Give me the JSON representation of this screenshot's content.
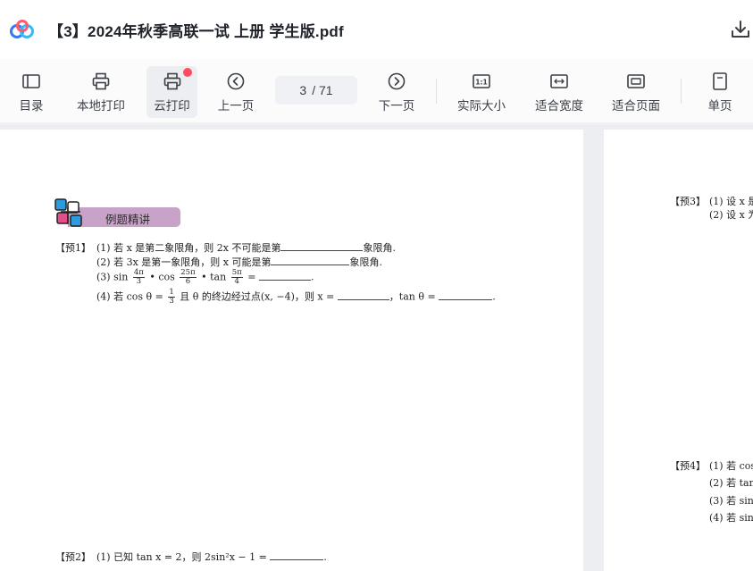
{
  "window": {
    "title": "【3】2024年秋季高联一试 上册 学生版.pdf"
  },
  "toolbar": {
    "toc": "目录",
    "local_print": "本地打印",
    "cloud_print": "云打印",
    "prev_page": "上一页",
    "page_current": "3",
    "page_total": "/ 71",
    "next_page": "下一页",
    "actual_size": "实际大小",
    "fit_width": "适合宽度",
    "fit_page": "适合页面",
    "single_page": "单页"
  },
  "colors": {
    "badge": "#ff4d5b",
    "logo_blue": "#2f7cf6",
    "banner": "#c9a2c9"
  },
  "page_left": {
    "section_banner": "例题精讲",
    "q1": {
      "tag": "【预1】",
      "l1_a": "(1) 若 x 是第二象限角，则 2x 不可能是第",
      "l1_b": "象限角.",
      "l2_a": "(2) 若 3x 是第一象限角，则 x 可能是第",
      "l2_b": "象限角.",
      "l3_a": "(3) sin",
      "l3_f1n": "4π",
      "l3_f1d": "3",
      "l3_b": "• cos",
      "l3_f2n": "25π",
      "l3_f2d": "6",
      "l3_c": "• tan",
      "l3_f3n": "5π",
      "l3_f3d": "4",
      "l3_d": "=",
      "l4_a": "(4) 若 cos θ =",
      "l4_fn": "1",
      "l4_fd": "3",
      "l4_b": "且 θ 的终边经过点(x, −4)，则 x =",
      "l4_c": "，tan θ ="
    },
    "q2": {
      "tag": "【预2】",
      "l1_a": "(1) 已知 tan x = 2，则 2sin²x − 1 ="
    }
  },
  "page_right": {
    "q3_tag": "【预3】",
    "q3_l1": "(1) 设 x 是",
    "q3_l2": "(2) 设 x 为",
    "q4_tag": "【预4】",
    "q4_l1": "(1) 若 cos",
    "q4_l2": "(2) 若 tan",
    "q4_l3": "(3) 若 sin",
    "q4_l4": "(4) 若 sin"
  }
}
